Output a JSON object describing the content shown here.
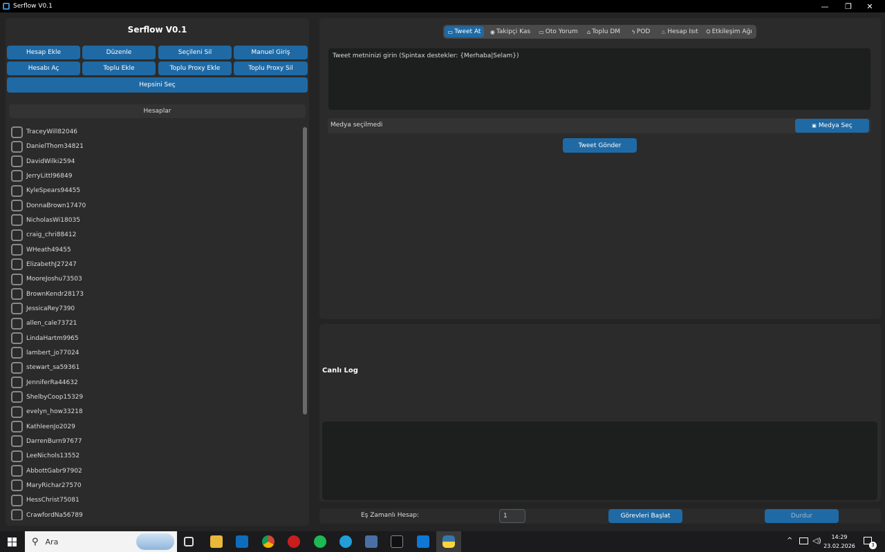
{
  "window": {
    "title": "Serflow V0.1",
    "min_glyph": "—",
    "max_glyph": "❐",
    "close_glyph": "✕"
  },
  "left": {
    "title": "Serflow V0.1",
    "buttons_row1": [
      "Hesap Ekle",
      "Düzenle",
      "Seçileni Sil",
      "Manuel Giriş"
    ],
    "buttons_row2": [
      "Hesabı Aç",
      "Toplu Ekle",
      "Toplu Proxy Ekle",
      "Toplu Proxy Sil"
    ],
    "select_all": "Hepsini Seç",
    "accounts_header": "Hesaplar",
    "accounts": [
      "TraceyWill82046",
      "DanielThom34821",
      "DavidWilki2594",
      "JerryLittl96849",
      "KyleSpears94455",
      "DonnaBrown17470",
      "NicholasWi18035",
      "craig_chri88412",
      "WHeath49455",
      "ElizabethJ27247",
      "MooreJoshu73503",
      "BrownKendr28173",
      "JessicaRey7390",
      "allen_cale73721",
      "LindaHartm9965",
      "lambert_jo77024",
      "stewart_sa59361",
      "JenniferRa44632",
      "ShelbyCoop15329",
      "evelyn_how33218",
      "KathleenJo2029",
      "DarrenBurn97677",
      "LeeNichols13552",
      "AbbottGabr97902",
      "MaryRichar27570",
      "HessChrist75081",
      "CrawfordNa56789"
    ]
  },
  "tabs": [
    {
      "icon": "▭",
      "label": "Tweet At",
      "active": true
    },
    {
      "icon": "◉",
      "label": "Takipçi Kas",
      "active": false
    },
    {
      "icon": "▭",
      "label": "Oto Yorum",
      "active": false
    },
    {
      "icon": "⌂",
      "label": "Toplu DM",
      "active": false
    },
    {
      "icon": "ϟ",
      "label": "POD",
      "active": false
    },
    {
      "icon": "♨",
      "label": "Hesap Isıt",
      "active": false
    },
    {
      "icon": "⛭",
      "label": "Etkileşim Ağı",
      "active": false
    }
  ],
  "tweet": {
    "placeholder": "Tweet metninizi girin (Spintax destekler: {Merhaba|Selam})",
    "media_status": "Medya seçilmedi",
    "media_button": "Medya Seç",
    "media_icon": "▣",
    "send_button": "Tweet Gönder"
  },
  "log": {
    "title": "Canlı Log"
  },
  "bottom": {
    "concurrent_label": "Eş Zamanlı Hesap:",
    "concurrent_value": "1",
    "start_button": "Görevleri Başlat",
    "stop_button": "Durdur"
  },
  "taskbar": {
    "search_text": "Ara",
    "time": "14:29",
    "date": "23.02.2026",
    "notification_count": "3"
  },
  "colors": {
    "accent": "#1f6aa5",
    "accent_disabled": "#1f6aa5"
  }
}
